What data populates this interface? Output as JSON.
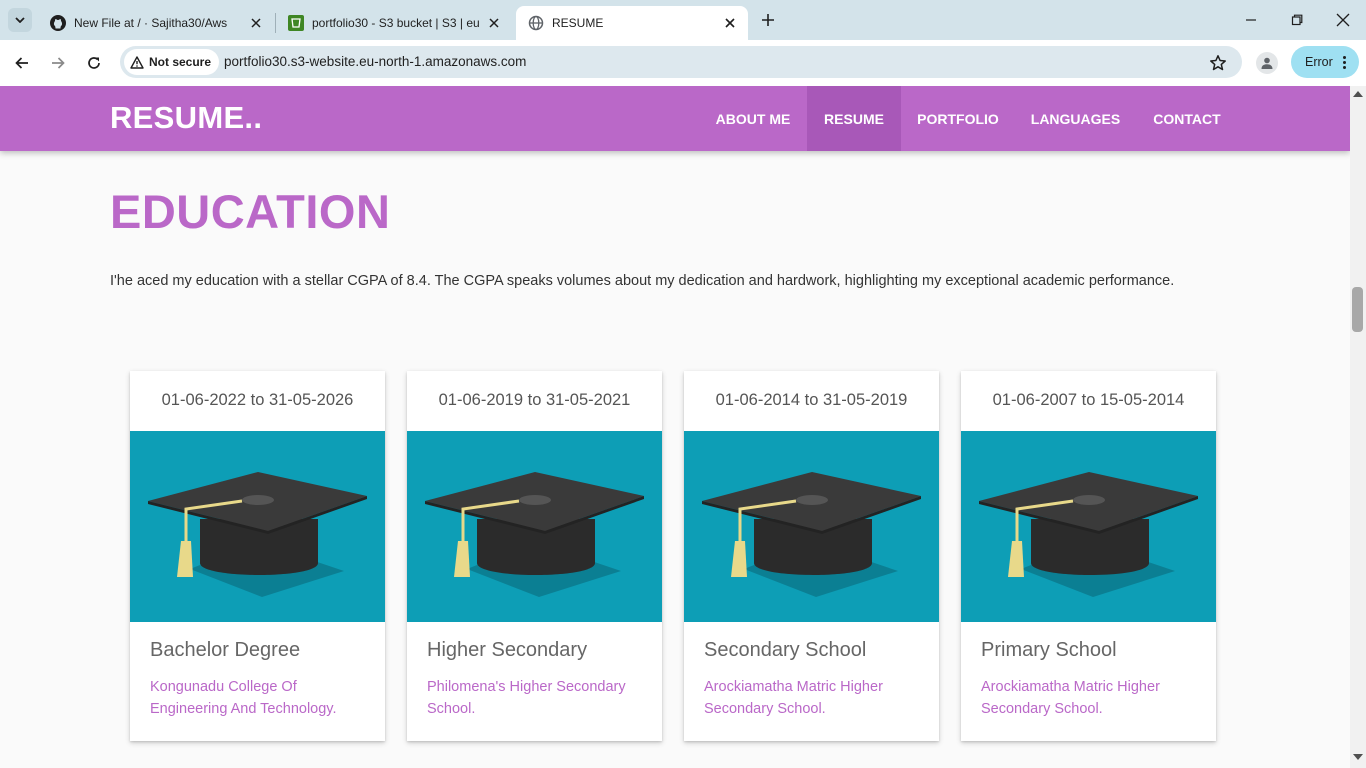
{
  "browser": {
    "tabs": [
      {
        "title": "New File at / · Sajitha30/Aws",
        "icon": "github-icon"
      },
      {
        "title": "portfolio30 - S3 bucket | S3 | eu",
        "icon": "aws-s3-icon"
      },
      {
        "title": "RESUME",
        "icon": "globe-icon",
        "active": true
      }
    ],
    "security_label": "Not secure",
    "url": "portfolio30.s3-website.eu-north-1.amazonaws.com",
    "error_label": "Error"
  },
  "site": {
    "brand": "RESUME..",
    "nav": [
      {
        "label": "ABOUT ME"
      },
      {
        "label": "RESUME",
        "active": true
      },
      {
        "label": "PORTFOLIO"
      },
      {
        "label": "LANGUAGES"
      },
      {
        "label": "CONTACT"
      }
    ],
    "accent_color": "#ba68c8",
    "education": {
      "title": "EDUCATION",
      "intro": "I'he aced my education with a stellar CGPA of 8.4. The CGPA speaks volumes about my dedication and hardwork, highlighting my exceptional academic performance.",
      "cards": [
        {
          "dates": "01-06-2022 to 31-05-2026",
          "degree": "Bachelor Degree",
          "school": "Kongunadu College Of Engineering And Technology.",
          "image": "graduation-cap-icon"
        },
        {
          "dates": "01-06-2019 to 31-05-2021",
          "degree": "Higher Secondary",
          "school": "Philomena's Higher Secondary School.",
          "image": "graduation-cap-icon"
        },
        {
          "dates": "01-06-2014 to 31-05-2019",
          "degree": "Secondary School",
          "school": "Arockiamatha Matric Higher Secondary School.",
          "image": "graduation-cap-icon"
        },
        {
          "dates": "01-06-2007 to 15-05-2014",
          "degree": "Primary School",
          "school": "Arockiamatha Matric Higher Secondary School.",
          "image": "graduation-cap-icon"
        }
      ]
    }
  }
}
